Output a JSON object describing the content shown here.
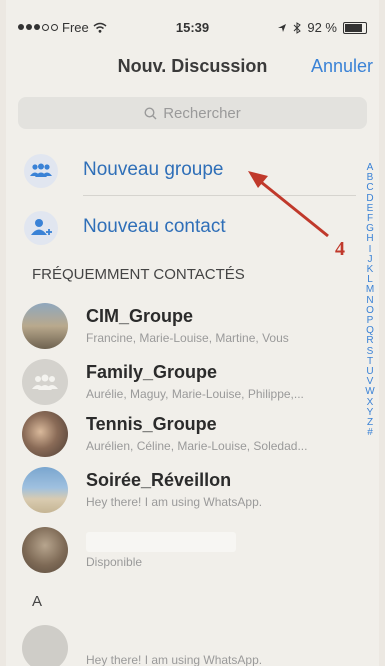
{
  "statusbar": {
    "carrier": "Free",
    "time": "15:39",
    "battery": "92 %",
    "battery_level": 0.92
  },
  "navbar": {
    "title": "Nouv. Discussion",
    "cancel": "Annuler"
  },
  "search": {
    "placeholder": "Rechercher"
  },
  "actions": [
    {
      "label": "Nouveau groupe",
      "icon": "group-icon"
    },
    {
      "label": "Nouveau contact",
      "icon": "add-contact-icon"
    }
  ],
  "sections": {
    "frequent": "FRÉQUEMMENT CONTACTÉS",
    "letter_a": "A"
  },
  "contacts": [
    {
      "name": "CIM_Groupe",
      "subtitle": "Francine, Marie-Louise, Martine, Vous"
    },
    {
      "name": "Family_Groupe",
      "subtitle": "Aurélie, Maguy, Marie-Louise, Philippe,..."
    },
    {
      "name": "Tennis_Groupe",
      "subtitle": "Aurélien, Céline, Marie-Louise, Soledad..."
    },
    {
      "name": "Soirée_Réveillon",
      "subtitle": "Hey there! I am using WhatsApp."
    },
    {
      "name": "",
      "subtitle": "Disponible"
    },
    {
      "name": "",
      "subtitle": "Hey there! I am using WhatsApp."
    }
  ],
  "index_letters": [
    "A",
    "B",
    "C",
    "D",
    "E",
    "F",
    "G",
    "H",
    "I",
    "J",
    "K",
    "L",
    "M",
    "N",
    "O",
    "P",
    "Q",
    "R",
    "S",
    "T",
    "U",
    "V",
    "W",
    "X",
    "Y",
    "Z",
    "#"
  ],
  "annotation": {
    "number": "4"
  },
  "colors": {
    "accent": "#3a82d6",
    "annotation": "#c0392b"
  }
}
